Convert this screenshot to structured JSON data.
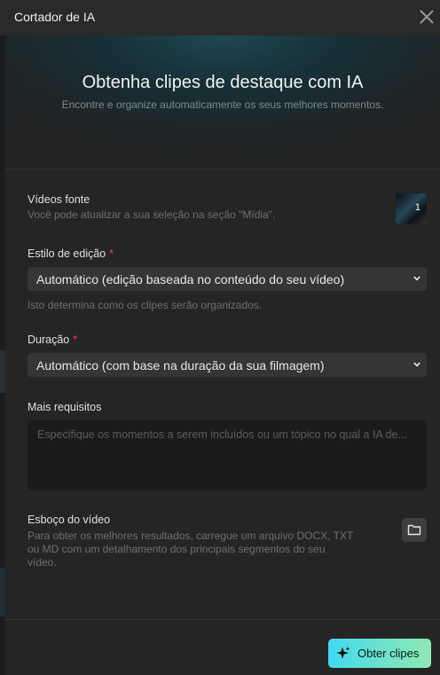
{
  "window": {
    "title": "Cortador de IA"
  },
  "hero": {
    "title": "Obtenha clipes de destaque com IA",
    "subtitle": "Encontre e organize automaticamente os seus melhores momentos."
  },
  "source_videos": {
    "label": "Vídeos fonte",
    "help": "Você pode atualizar a sua seleção na seção \"Mídia\".",
    "thumbnail_count": "1"
  },
  "edit_style": {
    "label": "Estilo de edição",
    "required_mark": "*",
    "value": "Automático (edição baseada no conteúdo do seu vídeo)",
    "help": "Isto determina como os clipes serão organizados."
  },
  "duration": {
    "label": "Duração",
    "required_mark": "*",
    "value": "Automático (com base na duração da sua filmagem)"
  },
  "requirements": {
    "label": "Mais requisitos",
    "placeholder": "Especifique os momentos a serem incluídos ou um tópico no qual a IA de..."
  },
  "outline": {
    "label": "Esboço do vídeo",
    "help_lines": [
      "Para obter os melhores resultados, carregue um arquivo DOCX, TXT",
      "ou MD com um detalhamento dos principais segmentos do seu",
      "vídeo."
    ],
    "upload_icon": "folder-icon"
  },
  "footer": {
    "submit_label": "Obter clipes",
    "submit_icon": "sparkle-icon"
  },
  "colors": {
    "dialog_bg": "#252525",
    "accent_gradient_start": "#41d9f0",
    "accent_gradient_end": "#8de9b3",
    "required": "#e5484d"
  }
}
